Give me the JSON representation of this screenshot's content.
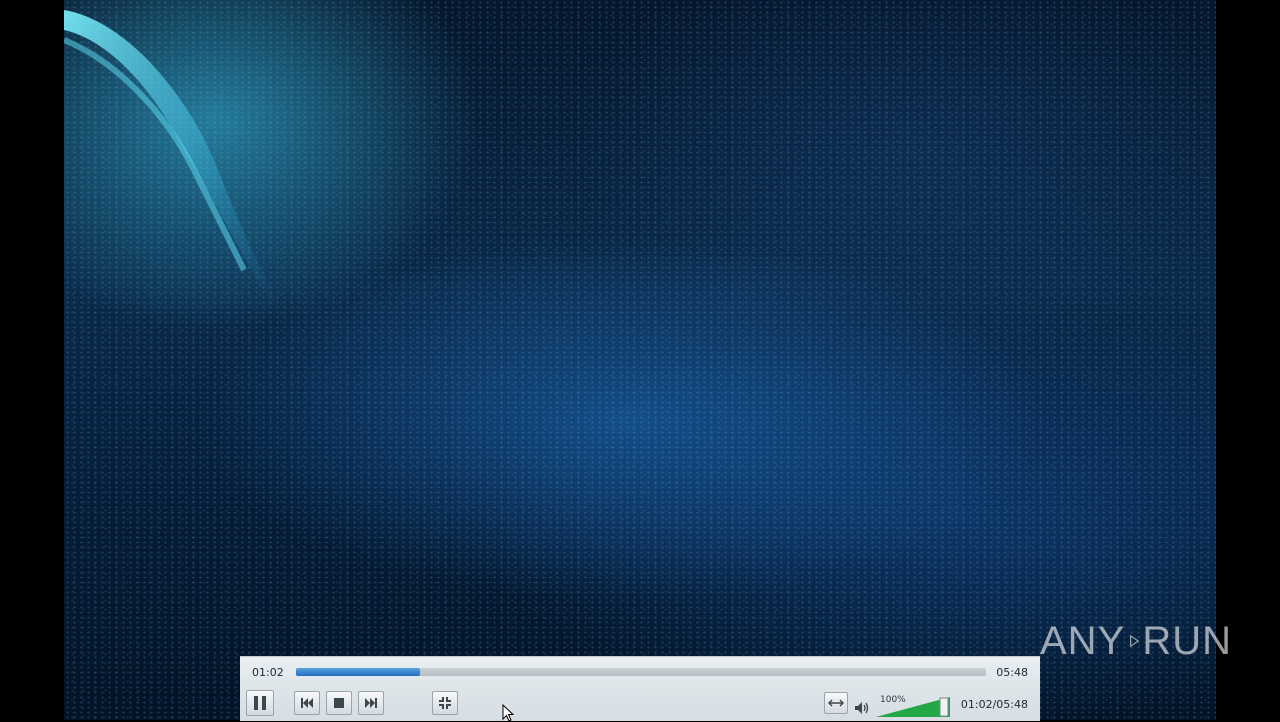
{
  "player": {
    "time_elapsed": "01:02",
    "time_total": "05:48",
    "time_combined": "01:02/05:48",
    "progress_fraction": 0.18,
    "volume_percent": "100%",
    "volume_fraction": 1.0,
    "buttons": {
      "pause": "pause-icon",
      "previous": "skip-previous-icon",
      "stop": "stop-icon",
      "next": "skip-next-icon",
      "fullscreen": "fullscreen-icon",
      "loop": "loop-icon"
    }
  },
  "watermark": {
    "text_left": "ANY",
    "text_right": "RUN"
  },
  "colors": {
    "seek_fill": "#1f6fbf",
    "volume_fill": "#22a845"
  }
}
